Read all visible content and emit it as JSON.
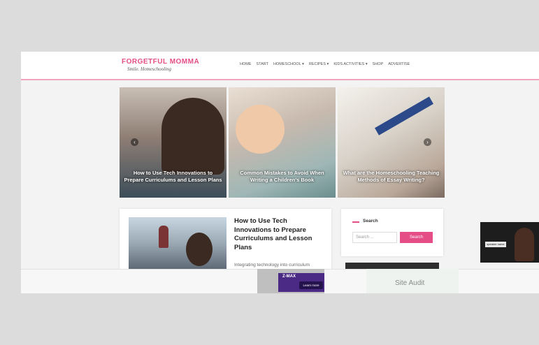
{
  "site": {
    "logo_main": "FORGETFUL MOMMA",
    "logo_sub": "Smile. Homeschooling"
  },
  "nav": [
    "HOME",
    "START",
    "HOMESCHOOL",
    "RECIPES",
    "KIDS ACTIVITIES",
    "SHOP",
    "ADVERTISE"
  ],
  "slider": {
    "slides": [
      {
        "title": "How to Use Tech Innovations to Prepare Curriculums and Lesson Plans"
      },
      {
        "title": "Common Mistakes to Avoid When Writing a Children's Book"
      },
      {
        "title": "What are the Homeschooling Teaching Methods of Essay Writing?"
      }
    ],
    "prev": "‹",
    "next": "›"
  },
  "post": {
    "title": "How to Use Tech Innovations to Prepare Curriculums and Lesson Plans",
    "excerpt": "Integrating technology into curriculum and lesson plan"
  },
  "search": {
    "title": "Search",
    "placeholder": "Search ...",
    "button": "Search"
  },
  "ads": {
    "left_logo": "Z-MAX",
    "left_cta": "Learn more",
    "right_text": "Site Audit"
  },
  "pip": {
    "label": "speaker name"
  }
}
